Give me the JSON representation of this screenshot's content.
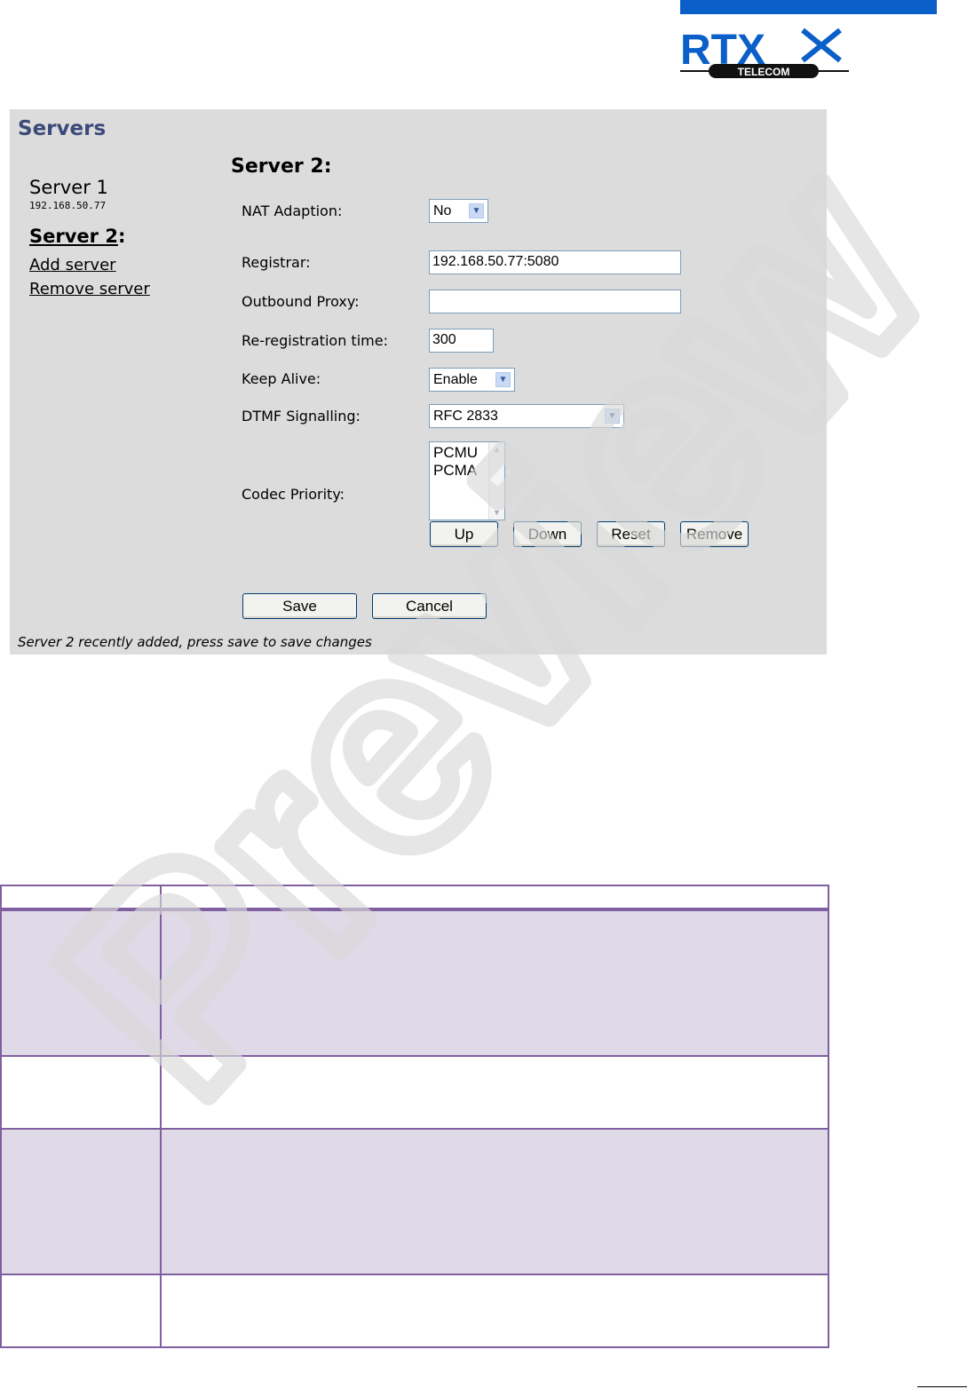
{
  "header": {
    "logo_text": "RTX",
    "logo_subtext": "TELECOM",
    "brand_color": "#0a5fc9"
  },
  "panel": {
    "title": "Servers",
    "sidebar": {
      "server1_label": "Server 1",
      "server1_ip": "192.168.50.77",
      "server2_label": "Server 2",
      "server2_suffix": ":",
      "add_server": "Add server",
      "remove_server": "Remove server"
    },
    "form": {
      "title": "Server 2:",
      "nat_label": "NAT Adaption:",
      "nat_value": "No",
      "registrar_label": "Registrar:",
      "registrar_value": "192.168.50.77:5080",
      "outbound_label": "Outbound Proxy:",
      "outbound_value": "",
      "rereg_label": "Re-registration time:",
      "rereg_value": "300",
      "keepalive_label": "Keep Alive:",
      "keepalive_value": "Enable",
      "dtmf_label": "DTMF Signalling:",
      "dtmf_value": "RFC 2833",
      "codec_label": "Codec Priority:",
      "codecs": [
        "PCMU",
        "PCMA"
      ],
      "btn_up": "Up",
      "btn_down": "Down",
      "btn_reset": "Reset",
      "btn_remove": "Remove",
      "btn_save": "Save",
      "btn_cancel": "Cancel"
    },
    "status": "Server 2 recently added, press save to save changes"
  },
  "watermark": {
    "text": "Preview"
  },
  "table": {
    "border_color": "#7f5fa0",
    "shaded_color": "#dfd9e8"
  }
}
